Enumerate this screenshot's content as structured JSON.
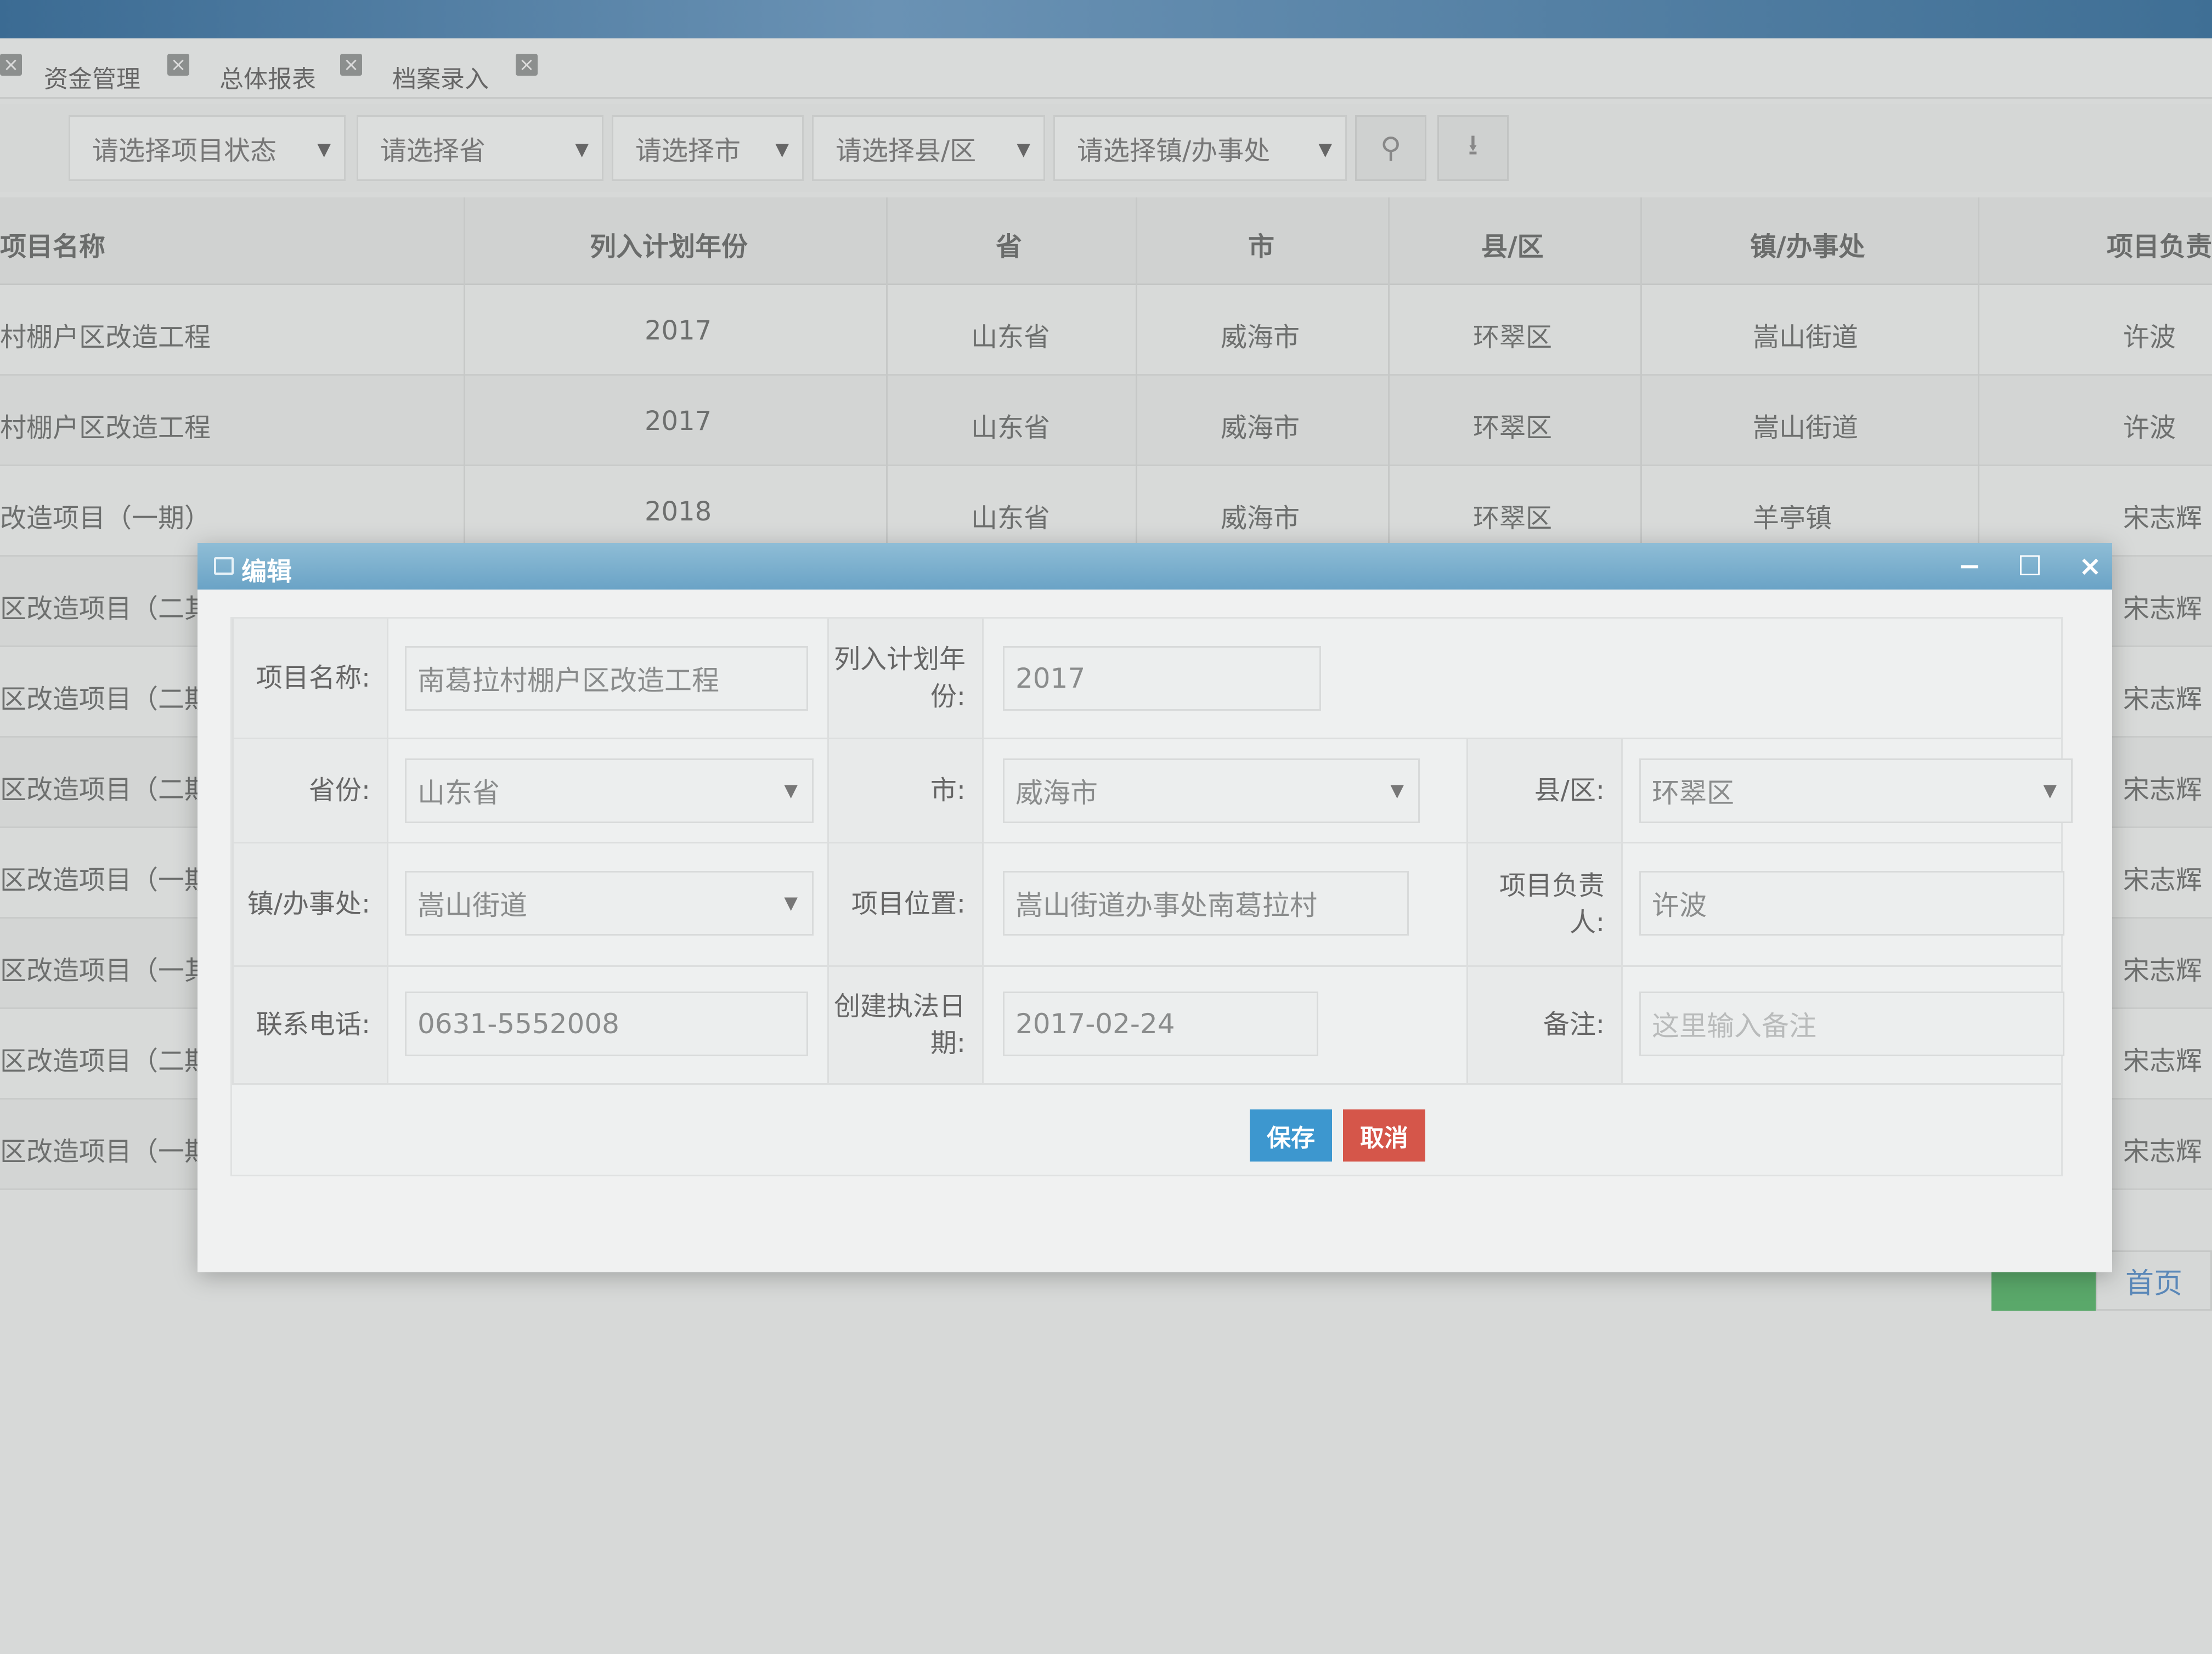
{
  "tabs": [
    {
      "label": "资金管理"
    },
    {
      "label": "总体报表"
    },
    {
      "label": "档案录入"
    }
  ],
  "filters": {
    "status": "请选择项目状态",
    "province": "请选择省",
    "city": "请选择市",
    "county": "请选择县/区",
    "town": "请选择镇/办事处"
  },
  "table": {
    "headers": {
      "name": "项目名称",
      "year": "列入计划年份",
      "province": "省",
      "city": "市",
      "county": "县/区",
      "town": "镇/办事处",
      "leader": "项目负责"
    },
    "rows": [
      {
        "name": "村棚户区改造工程",
        "year": "2017",
        "province": "山东省",
        "city": "威海市",
        "county": "环翠区",
        "town": "嵩山街道",
        "leader": "许波"
      },
      {
        "name": "村棚户区改造工程",
        "year": "2017",
        "province": "山东省",
        "city": "威海市",
        "county": "环翠区",
        "town": "嵩山街道",
        "leader": "许波"
      },
      {
        "name": "改造项目（一期）",
        "year": "2018",
        "province": "山东省",
        "city": "威海市",
        "county": "环翠区",
        "town": "羊亭镇",
        "leader": "宋志辉"
      },
      {
        "name": "区改造项目（二其",
        "year": "",
        "province": "",
        "city": "",
        "county": "",
        "town": "",
        "leader": "宋志辉"
      },
      {
        "name": "区改造项目（二期",
        "year": "",
        "province": "",
        "city": "",
        "county": "",
        "town": "",
        "leader": "宋志辉"
      },
      {
        "name": "区改造项目（二期",
        "year": "",
        "province": "",
        "city": "",
        "county": "",
        "town": "",
        "leader": "宋志辉"
      },
      {
        "name": "区改造项目（一期",
        "year": "",
        "province": "",
        "city": "",
        "county": "",
        "town": "",
        "leader": "宋志辉"
      },
      {
        "name": "区改造项目（一其",
        "year": "",
        "province": "",
        "city": "",
        "county": "",
        "town": "",
        "leader": "宋志辉"
      },
      {
        "name": "区改造项目（二期",
        "year": "",
        "province": "",
        "city": "",
        "county": "",
        "town": "",
        "leader": "宋志辉"
      },
      {
        "name": "区改造项目（一期",
        "year": "",
        "province": "",
        "city": "",
        "county": "",
        "town": "",
        "leader": "宋志辉"
      }
    ]
  },
  "pager": {
    "first": "首页"
  },
  "modal": {
    "title": "编辑",
    "labels": {
      "name": "项目名称:",
      "year": "列入计划年份:",
      "province": "省份:",
      "city": "市:",
      "county": "县/区:",
      "town": "镇/办事处:",
      "location": "项目位置:",
      "leader": "项目负责人:",
      "phone": "联系电话:",
      "date": "创建执法日期:",
      "remark": "备注:"
    },
    "values": {
      "name": "南葛拉村棚户区改造工程",
      "year": "2017",
      "province": "山东省",
      "city": "威海市",
      "county": "环翠区",
      "town": "嵩山街道",
      "location": "嵩山街道办事处南葛拉村",
      "leader": "许波",
      "phone": "0631-5552008",
      "date": "2017-02-24",
      "remark_placeholder": "这里输入备注"
    },
    "save_label": "保存",
    "cancel_label": "取消"
  }
}
